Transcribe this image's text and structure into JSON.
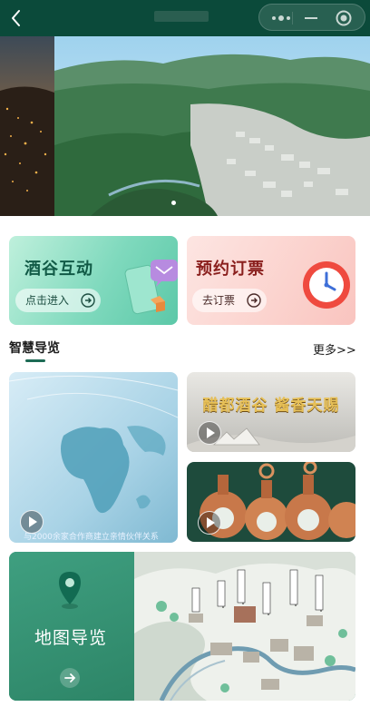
{
  "cards": {
    "interact": {
      "title": "酒谷互动",
      "button": "点击进入"
    },
    "ticket": {
      "title": "预约订票",
      "button": "去订票"
    }
  },
  "guide": {
    "title": "智慧导览",
    "more": "更多>>",
    "videos": [
      {
        "caption": "与2000余家合作商建立亲情伙伴关系"
      },
      {
        "overlay": "醋都酒谷  酱香天赐"
      },
      {
        "overlay": ""
      }
    ]
  },
  "map": {
    "title": "地图导览"
  },
  "colors": {
    "nav": "#0b4a3a",
    "accent_green": "#1d6b55",
    "ticket_red": "#8a1f1d"
  }
}
